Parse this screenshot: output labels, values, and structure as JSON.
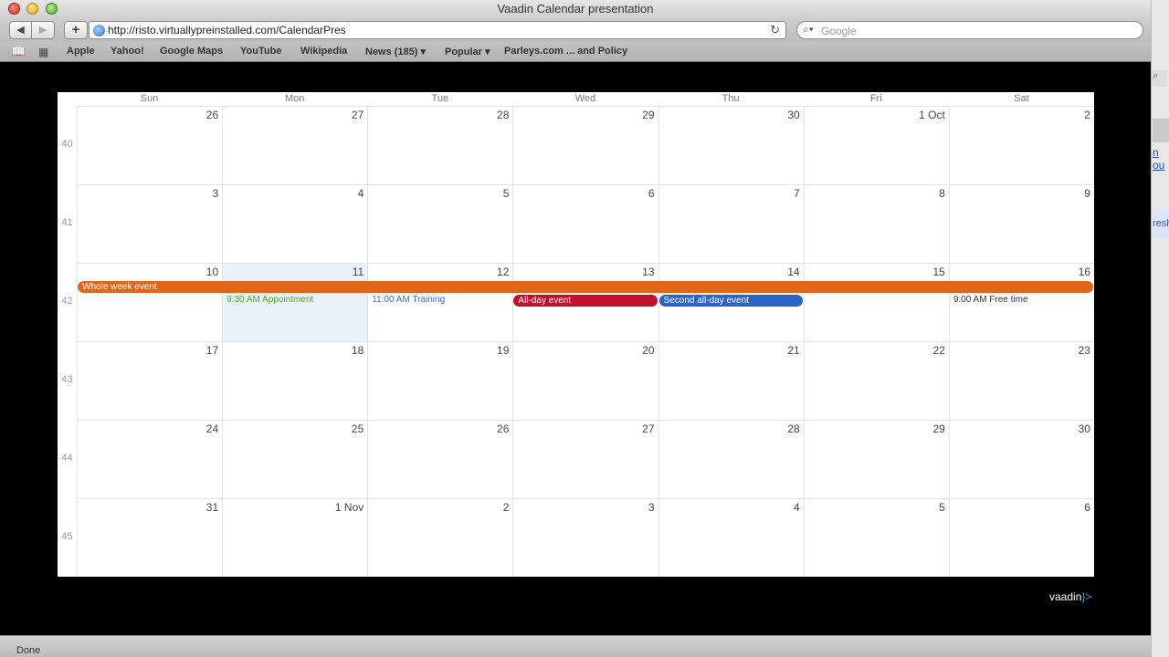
{
  "window": {
    "title": "Vaadin Calendar presentation"
  },
  "toolbar": {
    "back": "◀",
    "forward": "▶",
    "add": "+",
    "url": "http://risto.virtuallypreinstalled.com/CalendarPres",
    "reload": "↻",
    "search_placeholder": "Google"
  },
  "bookmarks": {
    "items": [
      "Apple",
      "Yahoo!",
      "Google Maps",
      "YouTube",
      "Wikipedia",
      "News (185) ▾",
      "Popular ▾",
      "Parleys.com ... and Policy"
    ]
  },
  "calendar": {
    "days": [
      "Sun",
      "Mon",
      "Tue",
      "Wed",
      "Thu",
      "Fri",
      "Sat"
    ],
    "weeks": [
      {
        "num": "40",
        "dates": [
          "26",
          "27",
          "28",
          "29",
          "30",
          "1 Oct",
          "2"
        ]
      },
      {
        "num": "41",
        "dates": [
          "3",
          "4",
          "5",
          "6",
          "7",
          "8",
          "9"
        ]
      },
      {
        "num": "42",
        "dates": [
          "10",
          "11",
          "12",
          "13",
          "14",
          "15",
          "16"
        ]
      },
      {
        "num": "43",
        "dates": [
          "17",
          "18",
          "19",
          "20",
          "21",
          "22",
          "23"
        ]
      },
      {
        "num": "44",
        "dates": [
          "24",
          "25",
          "26",
          "27",
          "28",
          "29",
          "30"
        ]
      },
      {
        "num": "45",
        "dates": [
          "31",
          "1 Nov",
          "2",
          "3",
          "4",
          "5",
          "6"
        ]
      }
    ],
    "events": {
      "whole_week": "Whole week event",
      "appointment": "9:30 AM Appointment",
      "training": "11:00 AM Training",
      "all_day": "All-day event",
      "second_all_day": "Second all-day event",
      "free_time": "9:00 AM Free time"
    },
    "colors": {
      "whole_week": "#e0661a",
      "all_day": "#c0102a",
      "second_all_day": "#2c63c9",
      "appointment": "#4caa2a",
      "training": "#3a6fb4",
      "free_time": "#333333"
    }
  },
  "footer": {
    "brand": "vaadin",
    "brand_suffix": "}>"
  },
  "status": {
    "text": "Done"
  },
  "side": {
    "link_fragment": "n ou",
    "chip_fragment": "resh"
  }
}
